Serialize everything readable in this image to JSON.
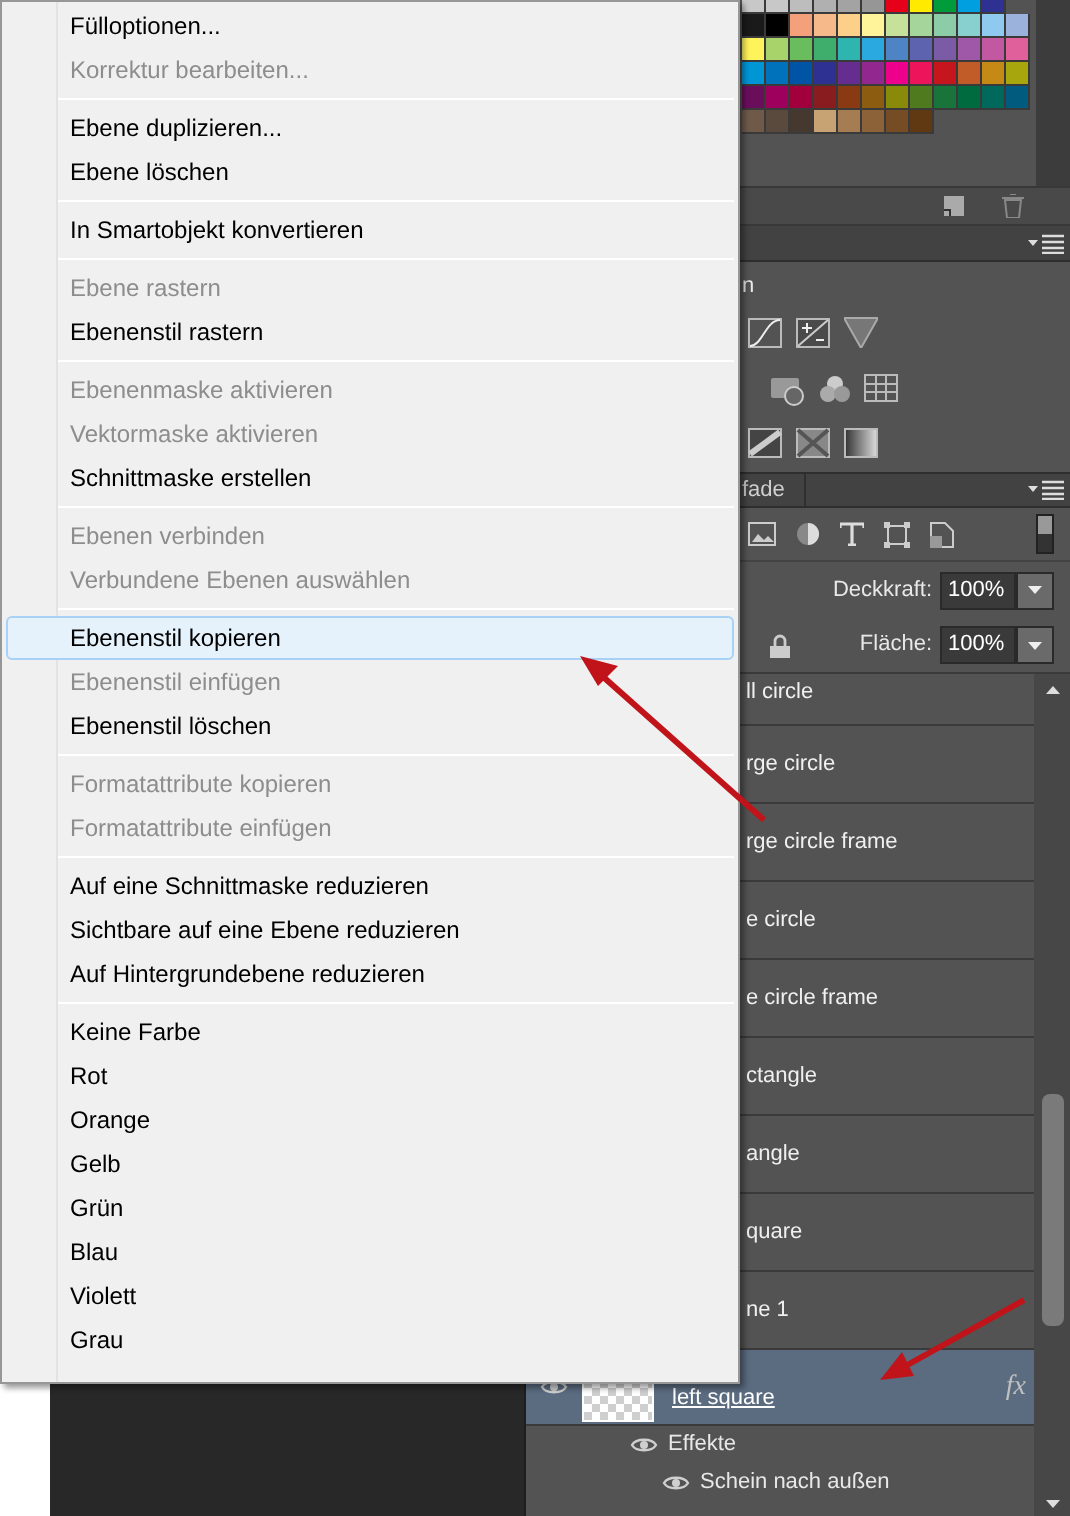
{
  "context_menu": {
    "groups": [
      [
        {
          "label": "Fülloptionen...",
          "disabled": false,
          "selected": false
        },
        {
          "label": "Korrektur bearbeiten...",
          "disabled": true,
          "selected": false
        }
      ],
      [
        {
          "label": "Ebene duplizieren...",
          "disabled": false,
          "selected": false
        },
        {
          "label": "Ebene löschen",
          "disabled": false,
          "selected": false
        }
      ],
      [
        {
          "label": "In Smartobjekt konvertieren",
          "disabled": false,
          "selected": false
        }
      ],
      [
        {
          "label": "Ebene rastern",
          "disabled": true,
          "selected": false
        },
        {
          "label": "Ebenenstil rastern",
          "disabled": false,
          "selected": false
        }
      ],
      [
        {
          "label": "Ebenenmaske aktivieren",
          "disabled": true,
          "selected": false
        },
        {
          "label": "Vektormaske aktivieren",
          "disabled": true,
          "selected": false
        },
        {
          "label": "Schnittmaske erstellen",
          "disabled": false,
          "selected": false
        }
      ],
      [
        {
          "label": "Ebenen verbinden",
          "disabled": true,
          "selected": false
        },
        {
          "label": "Verbundene Ebenen auswählen",
          "disabled": true,
          "selected": false
        }
      ],
      [
        {
          "label": "Ebenenstil kopieren",
          "disabled": false,
          "selected": true
        },
        {
          "label": "Ebenenstil einfügen",
          "disabled": true,
          "selected": false
        },
        {
          "label": "Ebenenstil löschen",
          "disabled": false,
          "selected": false
        }
      ],
      [
        {
          "label": "Formatattribute kopieren",
          "disabled": true,
          "selected": false
        },
        {
          "label": "Formatattribute einfügen",
          "disabled": true,
          "selected": false
        }
      ],
      [
        {
          "label": "Auf eine Schnittmaske reduzieren",
          "disabled": false,
          "selected": false
        },
        {
          "label": "Sichtbare auf eine Ebene reduzieren",
          "disabled": false,
          "selected": false
        },
        {
          "label": "Auf Hintergrundebene reduzieren",
          "disabled": false,
          "selected": false
        }
      ],
      [
        {
          "label": "Keine Farbe",
          "disabled": false,
          "selected": false
        },
        {
          "label": "Rot",
          "disabled": false,
          "selected": false
        },
        {
          "label": "Orange",
          "disabled": false,
          "selected": false
        },
        {
          "label": "Gelb",
          "disabled": false,
          "selected": false
        },
        {
          "label": "Grün",
          "disabled": false,
          "selected": false
        },
        {
          "label": "Blau",
          "disabled": false,
          "selected": false
        },
        {
          "label": "Violett",
          "disabled": false,
          "selected": false
        },
        {
          "label": "Grau",
          "disabled": false,
          "selected": false
        }
      ]
    ]
  },
  "adjustments_panel": {
    "title": "n"
  },
  "paths_tab": {
    "label": "fade"
  },
  "layers_panel": {
    "opacity": {
      "label": "Deckkraft:",
      "value": "100%"
    },
    "fill": {
      "label": "Fläche:",
      "value": "100%"
    },
    "layers": [
      {
        "name": "ll circle",
        "selected": false
      },
      {
        "name": "rge circle",
        "selected": false
      },
      {
        "name": "rge circle frame",
        "selected": false
      },
      {
        "name": "e circle",
        "selected": false
      },
      {
        "name": "e circle frame",
        "selected": false
      },
      {
        "name": "ctangle",
        "selected": false
      },
      {
        "name": "angle",
        "selected": false
      },
      {
        "name": "quare",
        "selected": false
      },
      {
        "name": "ne 1",
        "selected": false
      },
      {
        "name": "left square",
        "selected": true,
        "fx": "fx",
        "children": [
          {
            "name": "Effekte",
            "children": [
              {
                "name": "Schein nach außen"
              }
            ]
          }
        ]
      }
    ]
  }
}
